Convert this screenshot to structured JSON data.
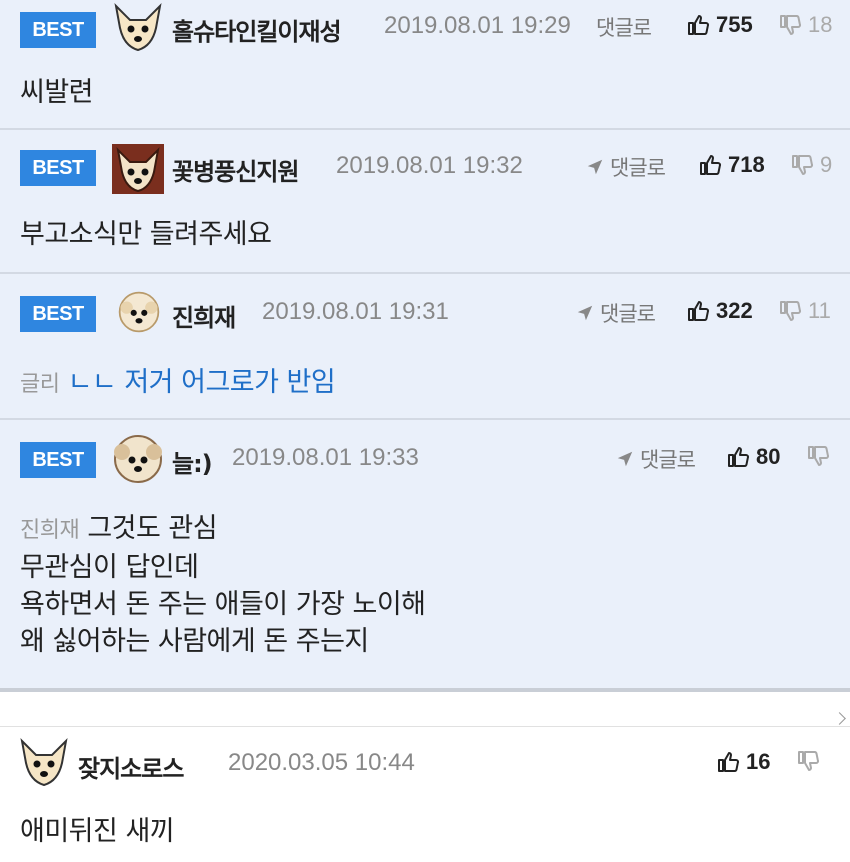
{
  "best_label": "BEST",
  "reply_label": "댓글로",
  "best_comments": [
    {
      "nick": "홀슈타인킬이재성",
      "date": "2019.08.01 19:29",
      "likes": "755",
      "dislikes": "18",
      "text": "씨발련"
    },
    {
      "nick": "꽃병풍신지원",
      "date": "2019.08.01 19:32",
      "likes": "718",
      "dislikes": "9",
      "text": "부고소식만 들려주세요"
    },
    {
      "nick": "진희재",
      "date": "2019.08.01 19:31",
      "likes": "322",
      "dislikes": "11",
      "ref_prefix": "글리",
      "text": "ㄴㄴ 저거 어그로가 반임"
    },
    {
      "nick": "늘:)",
      "date": "2019.08.01 19:33",
      "likes": "80",
      "dislikes": "",
      "ref_prefix": "진희재",
      "lines": [
        "그것도 관심",
        "무관심이 답인데",
        "욕하면서 돈 주는 애들이 가장 노이해",
        "왜 싫어하는 사람에게 돈 주는지"
      ]
    }
  ],
  "normal_comments": [
    {
      "nick": "잦지소로스",
      "date": "2020.03.05 10:44",
      "likes": "16",
      "dislikes": "",
      "text": "애미뒤진 새끼"
    }
  ],
  "icons": {
    "like": "thumbs-up-icon",
    "dislike": "thumbs-down-icon",
    "reply": "reply-arrow-icon"
  },
  "colors": {
    "best_badge": "#2f86e0",
    "best_bg": "#eaf0fa",
    "link_blue": "#1f6fc8"
  }
}
